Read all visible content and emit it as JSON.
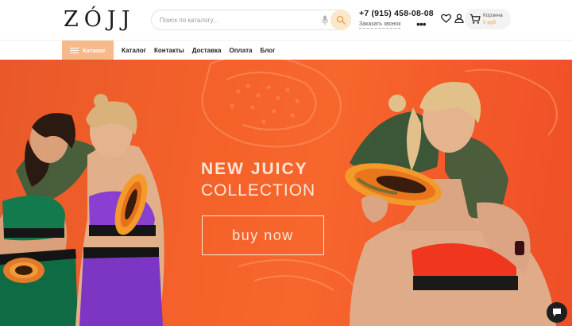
{
  "header": {
    "logo": "ZÓJJ",
    "search": {
      "placeholder": "Поиск по каталогу..."
    },
    "phone": "+7 (915) 458-08-08",
    "callback_label": "Заказать звонок",
    "more_label": "•••",
    "cart": {
      "label": "Корзина",
      "sum": "0 руб"
    },
    "icons": [
      "search-icon",
      "microphone-icon",
      "heart-icon",
      "user-icon",
      "cart-icon"
    ]
  },
  "nav": {
    "catalog_button": "Каталог",
    "links": [
      "Каталог",
      "Контакты",
      "Доставка",
      "Оплата",
      "Блог"
    ]
  },
  "hero": {
    "title_line1": "NEW JUICY",
    "title_line2": "COLLECTION",
    "cta": "buy now"
  },
  "colors": {
    "accent": "#f7b98a",
    "accent_search": "#fbe7cc",
    "cart_sum": "#f19a3e",
    "hero_bg": "#f4612a",
    "hero_text": "#fde6d7",
    "green_outfit": "#137a4e",
    "purple_outfit": "#8a3fd0",
    "red_top": "#f0361e"
  }
}
